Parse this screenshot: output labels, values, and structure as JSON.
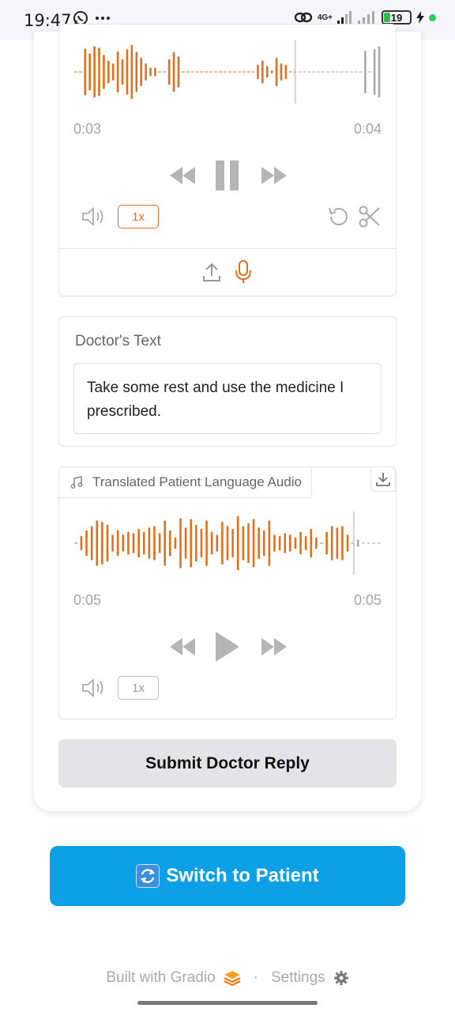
{
  "status_bar": {
    "time": "19:47",
    "network": "4G+",
    "battery": "19"
  },
  "doctor_recorder": {
    "current_time": "0:03",
    "total_time": "0:04",
    "speed": "1x",
    "playhead_progress": 0.72
  },
  "doctor_text": {
    "label": "Doctor's Text",
    "value": "Take some rest and use the medicine I prescribed."
  },
  "patient_audio": {
    "label": "Translated Patient Language Audio",
    "current_time": "0:05",
    "total_time": "0:05",
    "speed": "1x",
    "playhead_progress": 0.91
  },
  "submit_button": {
    "label": "Submit Doctor Reply"
  },
  "switch_button": {
    "label": "Switch to Patient"
  },
  "footer": {
    "built_with": "Built with Gradio",
    "separator": "·",
    "settings": "Settings"
  },
  "colors": {
    "accent": "#e07020",
    "wave_played": "#e07020",
    "wave_unplayed": "#a8a8a8",
    "primary_button": "#0ea0e6",
    "secondary_button": "#e4e4e7"
  }
}
